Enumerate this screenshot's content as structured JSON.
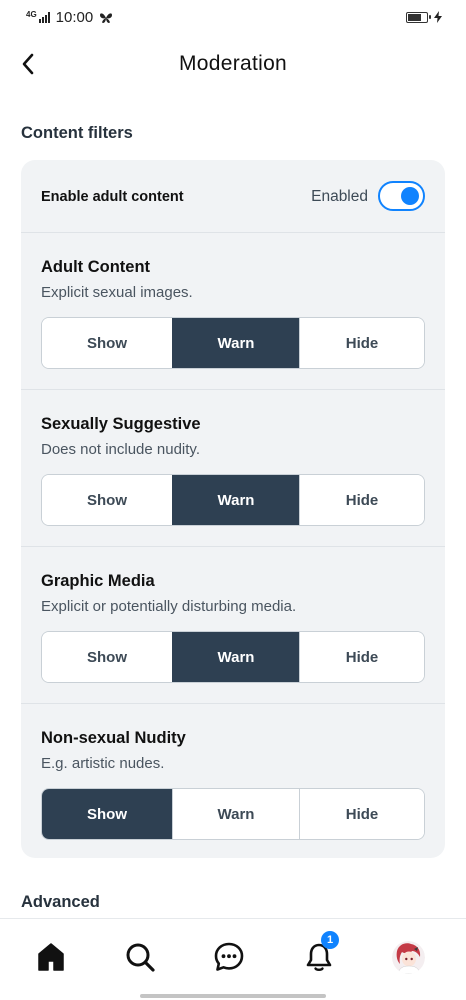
{
  "status_bar": {
    "network": "4G",
    "time": "10:00"
  },
  "header": {
    "title": "Moderation"
  },
  "content_filters": {
    "section_title": "Content filters",
    "enable_adult": {
      "label": "Enable adult content",
      "status": "Enabled",
      "on": true
    },
    "filters": [
      {
        "name": "Adult Content",
        "description": "Explicit sexual images.",
        "options": [
          "Show",
          "Warn",
          "Hide"
        ],
        "selected": "Warn"
      },
      {
        "name": "Sexually Suggestive",
        "description": "Does not include nudity.",
        "options": [
          "Show",
          "Warn",
          "Hide"
        ],
        "selected": "Warn"
      },
      {
        "name": "Graphic Media",
        "description": "Explicit or potentially disturbing media.",
        "options": [
          "Show",
          "Warn",
          "Hide"
        ],
        "selected": "Warn"
      },
      {
        "name": "Non-sexual Nudity",
        "description": "E.g. artistic nudes.",
        "options": [
          "Show",
          "Warn",
          "Hide"
        ],
        "selected": "Show"
      }
    ]
  },
  "advanced": {
    "section_title": "Advanced"
  },
  "bottom_nav": {
    "items": [
      {
        "icon": "home-icon"
      },
      {
        "icon": "search-icon"
      },
      {
        "icon": "chat-icon"
      },
      {
        "icon": "bell-icon",
        "badge": "1"
      },
      {
        "icon": "avatar"
      }
    ]
  },
  "colors": {
    "accent": "#1083fe",
    "selected_segment": "#2e4052",
    "card_background": "#f1f3f5"
  }
}
